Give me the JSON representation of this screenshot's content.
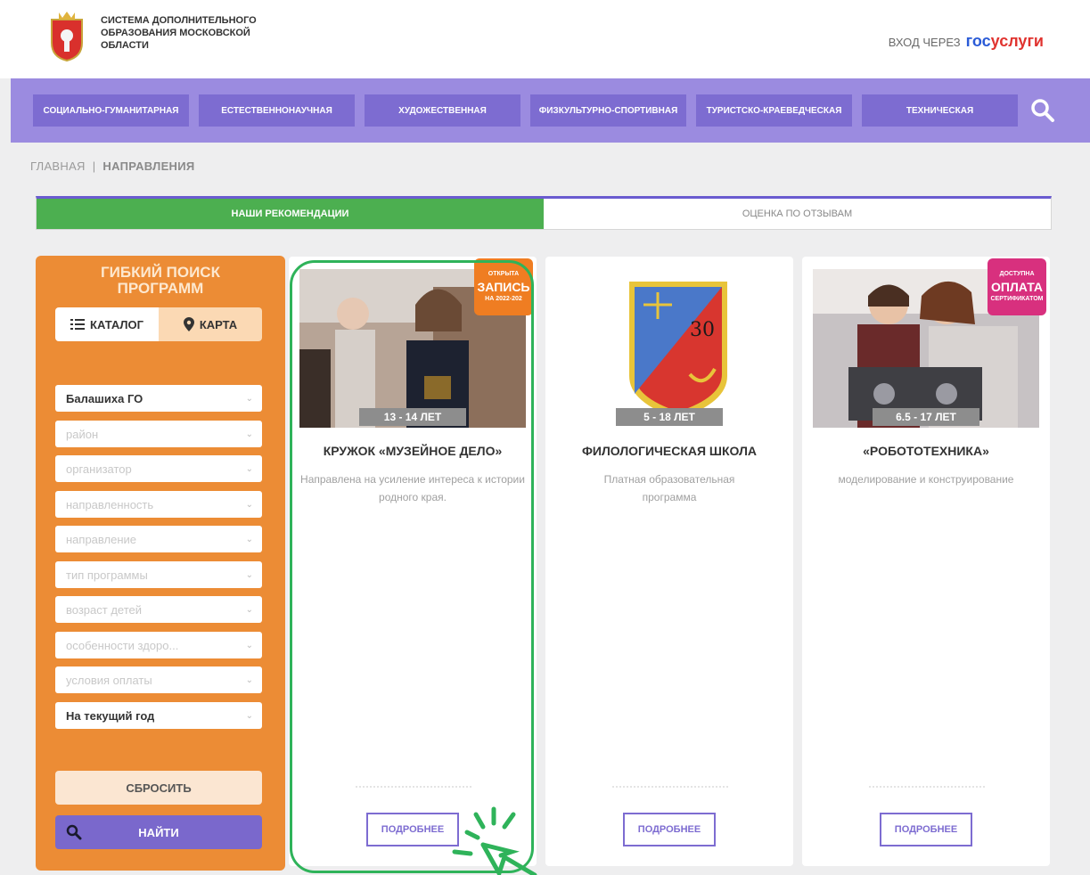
{
  "header": {
    "org_name": "Система дополнительного образования Московской области",
    "login_prefix": "вход через",
    "gos": "гос",
    "uslugi": "услуги"
  },
  "nav": {
    "items": [
      {
        "label": "Социально-гуманитарная"
      },
      {
        "label": "Естественнонаучная"
      },
      {
        "label": "Художественная"
      },
      {
        "label": "Физкультурно-спортивная"
      },
      {
        "label": "Туристско-краеведческая"
      },
      {
        "label": "Техническая"
      }
    ]
  },
  "breadcrumb": {
    "home": "Главная",
    "separator": "|",
    "current": "Направления"
  },
  "tabs": {
    "recommendations": "Наши рекомендации",
    "reviews": "Оценка по отзывам"
  },
  "sidebar": {
    "title": "Гибкий поиск программ",
    "catalog": "Каталог",
    "map": "Карта",
    "filters": [
      {
        "value": "Балашиха ГО",
        "filled": true
      },
      {
        "value": "район",
        "filled": false
      },
      {
        "value": "организатор",
        "filled": false
      },
      {
        "value": "направленность",
        "filled": false
      },
      {
        "value": "направление",
        "filled": false
      },
      {
        "value": "тип программы",
        "filled": false
      },
      {
        "value": "возраст детей",
        "filled": false
      },
      {
        "value": "особенности здоро...",
        "filled": false
      },
      {
        "value": "условия оплаты",
        "filled": false
      },
      {
        "value": "На текущий год",
        "filled": true
      }
    ],
    "reset": "Сбросить",
    "find": "Найти"
  },
  "cards": [
    {
      "age": "13 - 14 лет",
      "title": "Кружок «Музейное дело»",
      "desc": "Направлена на усиление интереса к истории родного края.",
      "more": "Подробнее",
      "badge": {
        "top": "открыта",
        "main": "запись",
        "bottom": "на 2022-202"
      }
    },
    {
      "age": "5 - 18 лет",
      "title": "Филологическая школа",
      "desc": "Платная образовательная программа",
      "more": "Подробнее",
      "emblem_number": "30"
    },
    {
      "age": "6.5 - 17 лет",
      "title": "«Робототехника»",
      "desc": "моделирование и конструирование",
      "more": "Подробнее",
      "badge": {
        "top": "доступна",
        "main": "оплата",
        "bottom": "сертификатом"
      }
    }
  ],
  "colors": {
    "nav_bg": "#9b8be0",
    "nav_item": "#7d6cd1",
    "tab_active": "#4caf50",
    "sidebar": "#ec8c35",
    "badge_open": "#ef7d22",
    "badge_pay": "#d8307e",
    "highlight": "#2fb35a"
  }
}
